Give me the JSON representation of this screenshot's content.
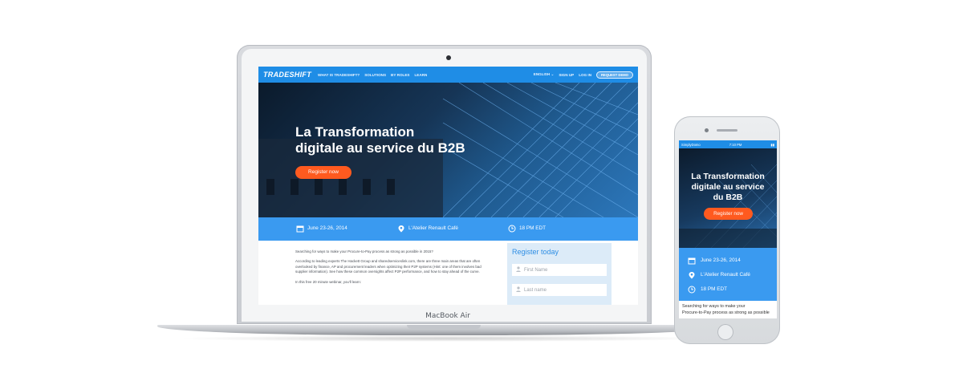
{
  "laptop": {
    "brand": "MacBook Air",
    "site": {
      "nav": {
        "logo": "TRADESHIFT",
        "links": [
          "WHAT IS TRADESHIFT?",
          "SOLUTIONS",
          "BY ROLES",
          "LEARN"
        ],
        "language": "ENGLISH",
        "signup": "SIGN UP",
        "login": "LOG IN",
        "demo": "REQUEST DEMO"
      },
      "hero": {
        "title_line1": "La Transformation",
        "title_line2": "digitale au service du B2B",
        "cta": "Register now"
      },
      "info": {
        "date": "June 23-26, 2014",
        "location": "L'Atelier Renault Café",
        "time": "18 PM EDT"
      },
      "body": {
        "p1": "Searching for ways to make your Procure-to-Pay process as strong as possible in 2015?",
        "p2": "According to leading experts The Hackett Group and sharedserviceslink.com, there are three main areas that are often overlooked by finance, AP and procurement leaders when optimizing their P2P systems (Hint: one of them involves bad supplier information). See how these common oversights affect P2P performance, and how to stay ahead of the curve.",
        "p3": "In this free 20 minute webinar, you'll learn:"
      },
      "form": {
        "title": "Register today",
        "first_name_placeholder": "First Name",
        "last_name_placeholder": "Last name"
      }
    }
  },
  "phone": {
    "status": {
      "carrier": "SimplyDomo",
      "time": "7:10 PM"
    },
    "hero": {
      "title_line1": "La Transformation",
      "title_line2": "digitale au service",
      "title_line3": "du B2B",
      "cta": "Register now"
    },
    "info": {
      "date": "June 23-26, 2014",
      "location": "L'Atelier Renault Café",
      "time": "18 PM EDT"
    },
    "body": {
      "line1": "Searching for ways to make your",
      "line2": "Procure-to-Pay process as strong as possible"
    }
  },
  "colors": {
    "brand_blue": "#1f8de6",
    "info_blue": "#3a9af0",
    "cta_orange": "#ff5a1f",
    "form_bg": "#dcebf8"
  }
}
